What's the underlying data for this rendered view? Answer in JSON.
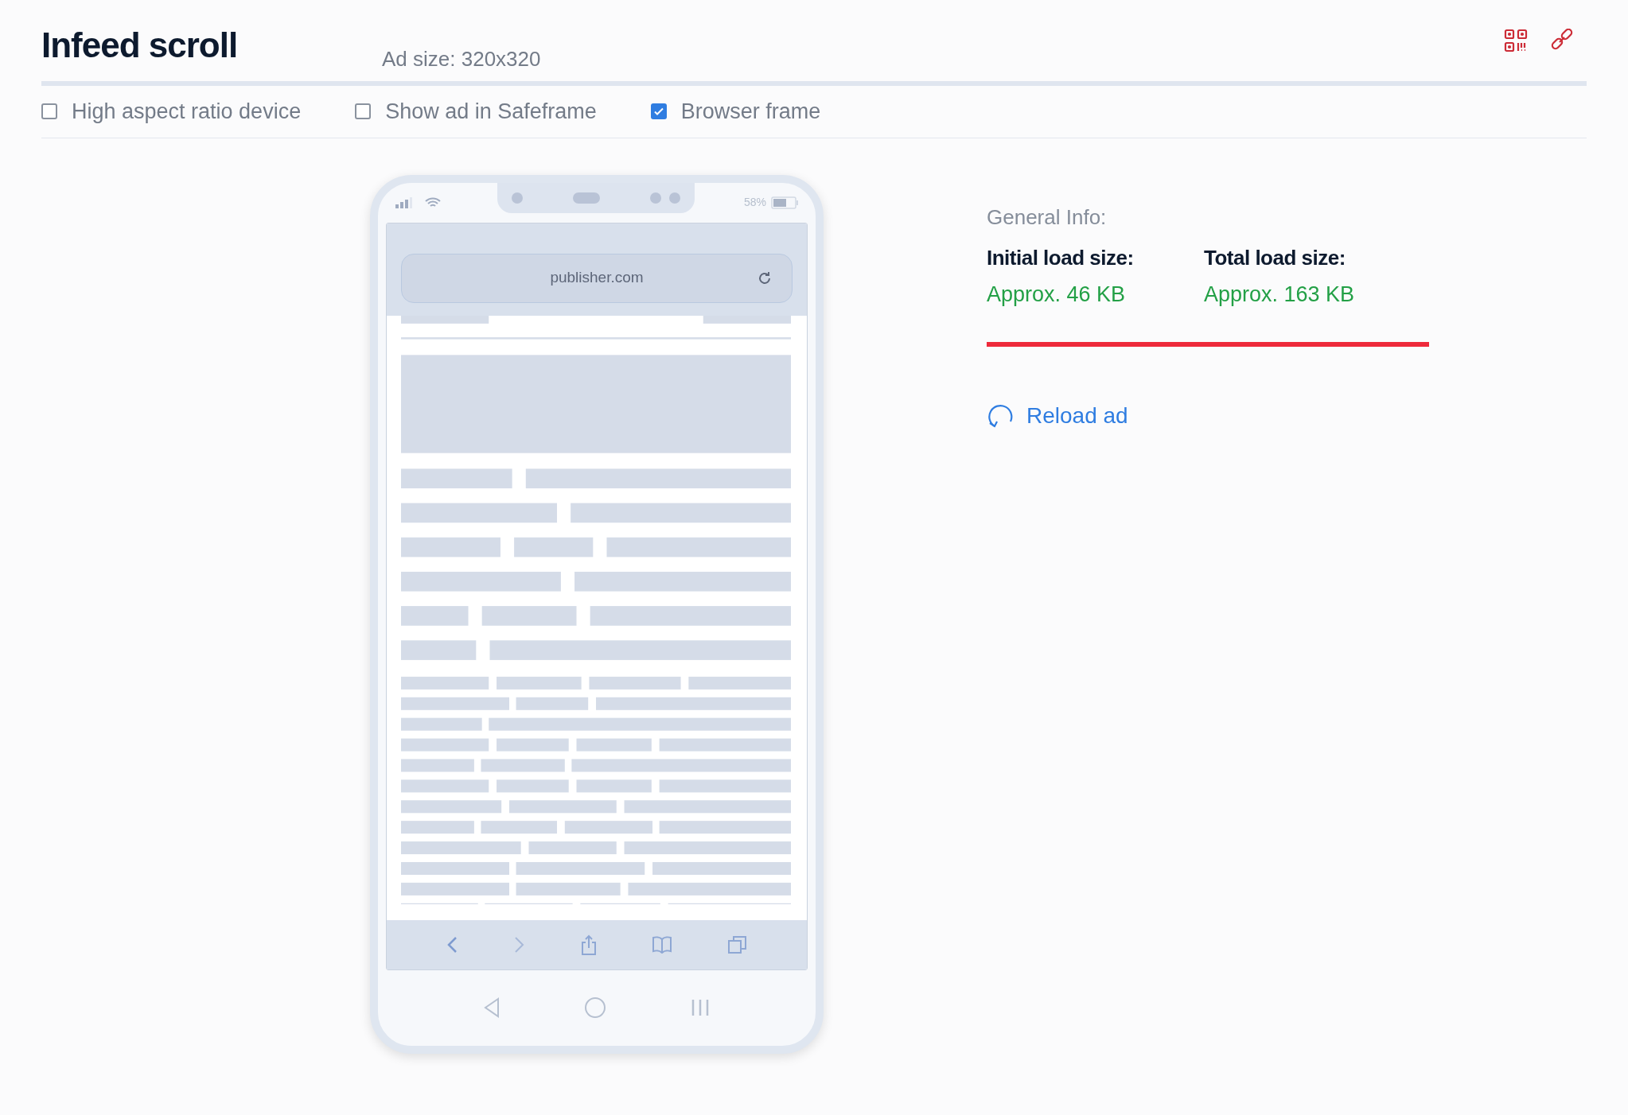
{
  "header": {
    "title": "Infeed scroll",
    "ad_size": "Ad size: 320x320"
  },
  "options": [
    {
      "label": "High aspect ratio device",
      "checked": false
    },
    {
      "label": "Show ad in Safeframe",
      "checked": false
    },
    {
      "label": "Browser frame",
      "checked": true
    }
  ],
  "phone": {
    "battery": "58%",
    "url": "publisher.com"
  },
  "info": {
    "heading": "General Info:",
    "stats": [
      {
        "label": "Initial load size:",
        "value": "Approx. 46 KB"
      },
      {
        "label": "Total load size:",
        "value": "Approx. 163 KB"
      }
    ],
    "reload": "Reload ad"
  }
}
